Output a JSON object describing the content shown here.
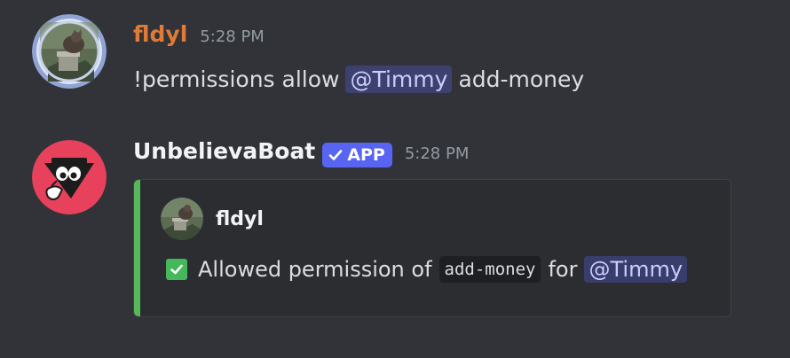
{
  "messages": [
    {
      "username": "fldyl",
      "timestamp": "5:28 PM",
      "content": {
        "before": "!permissions allow",
        "mention": "@Timmy",
        "after": "add-money"
      }
    },
    {
      "username": "UnbelievaBoat",
      "badge": "APP",
      "timestamp": "5:28 PM",
      "embed": {
        "author": "fldyl",
        "bar_color": "#57b85b",
        "description": {
          "emoji": "white-check-mark",
          "before": "Allowed permission of",
          "code": "add-money",
          "middle": "for",
          "mention": "@Timmy"
        }
      }
    }
  ],
  "colors": {
    "background": "#313338",
    "username_fldyl": "#e07a35",
    "badge": "#5865f2",
    "mention_bg": "#3c4270",
    "mention_text": "#c9cdfb",
    "bot_avatar": "#e8415c"
  }
}
